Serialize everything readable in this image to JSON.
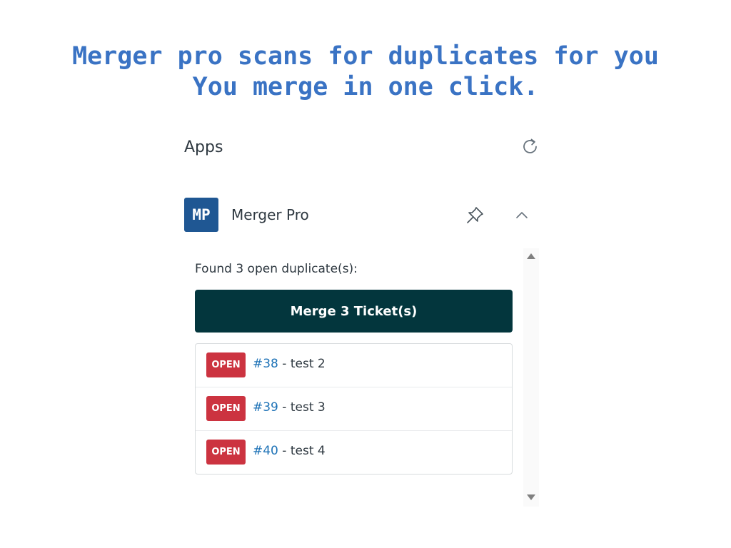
{
  "headline": {
    "line1": "Merger pro scans for duplicates for you",
    "line2": "You merge in one click."
  },
  "apps_panel": {
    "title": "Apps",
    "refresh_icon": "refresh-icon"
  },
  "app": {
    "logo_text": "MP",
    "name": "Merger Pro",
    "logo_color": "#1f5793",
    "pin_icon": "pin-icon",
    "collapse_icon": "chevron-up-icon"
  },
  "duplicates": {
    "found_text": "Found 3 open duplicate(s):",
    "merge_button_label": "Merge 3 Ticket(s)",
    "merge_button_color": "#03363d",
    "badge_color": "#cc3340",
    "link_color": "#1f73b7",
    "tickets": [
      {
        "status": "OPEN",
        "id": "#38",
        "separator": " - ",
        "title": "test 2"
      },
      {
        "status": "OPEN",
        "id": "#39",
        "separator": " - ",
        "title": "test 3"
      },
      {
        "status": "OPEN",
        "id": "#40",
        "separator": " - ",
        "title": "test 4"
      }
    ]
  }
}
